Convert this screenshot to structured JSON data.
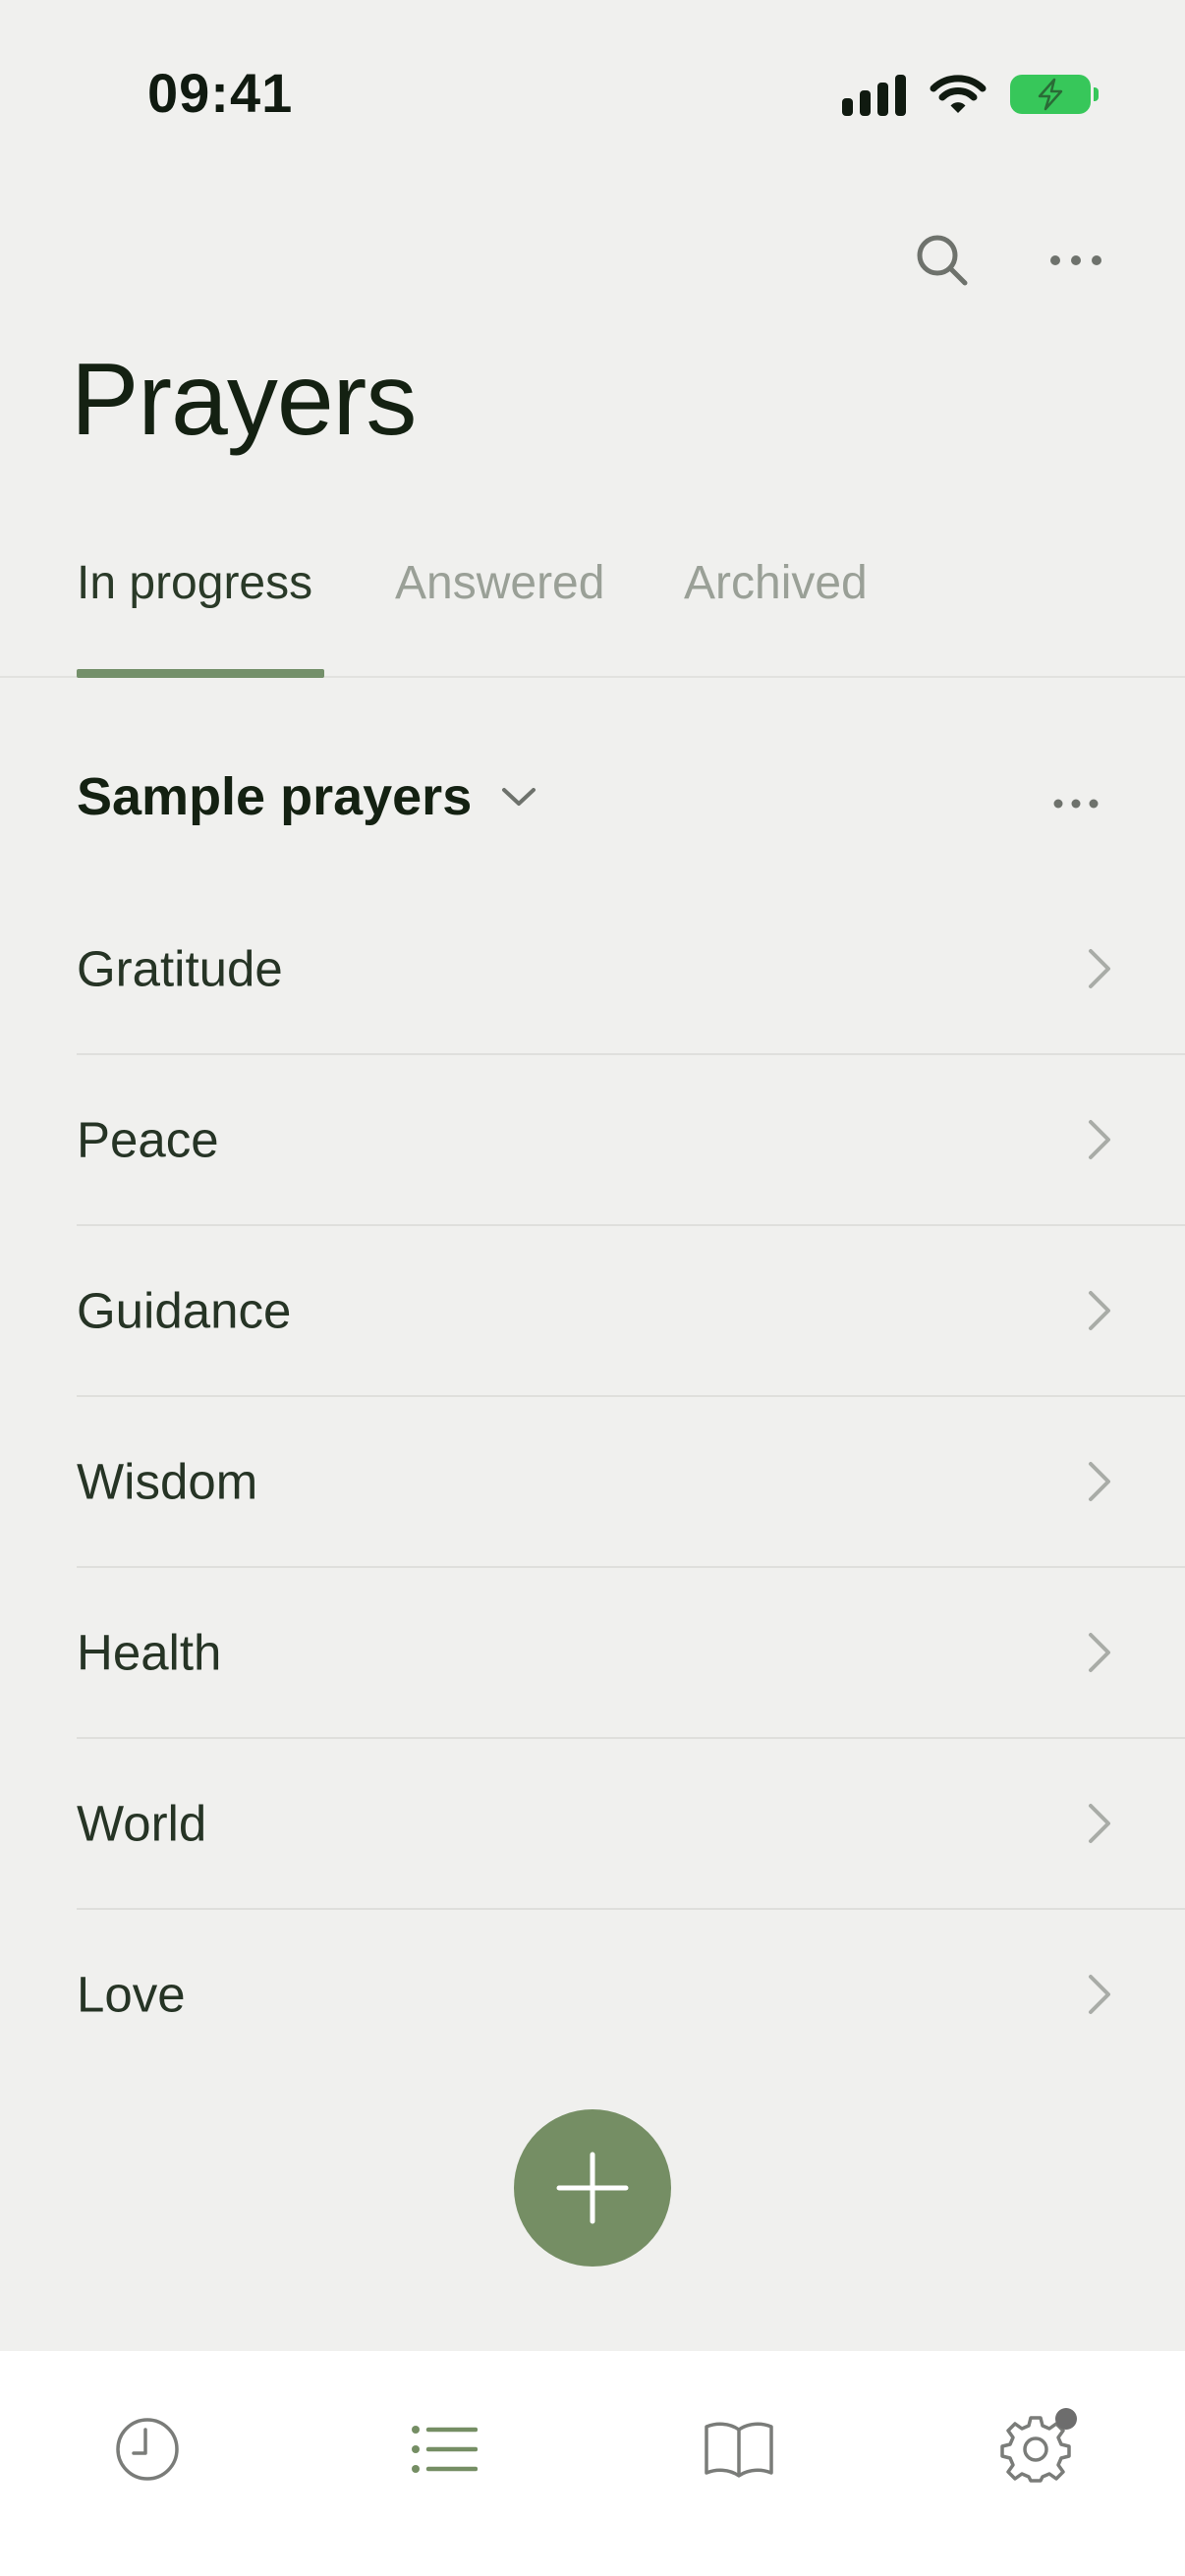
{
  "status_bar": {
    "time": "09:41"
  },
  "header": {
    "title": "Prayers",
    "icons": [
      "search-icon",
      "more-icon"
    ]
  },
  "tabs": [
    {
      "label": "In progress",
      "active": true
    },
    {
      "label": "Answered",
      "active": false
    },
    {
      "label": "Archived",
      "active": false
    }
  ],
  "section": {
    "title": "Sample prayers",
    "icons": [
      "chevron-down-icon",
      "more-icon"
    ]
  },
  "prayers": [
    {
      "label": "Gratitude"
    },
    {
      "label": "Peace"
    },
    {
      "label": "Guidance"
    },
    {
      "label": "Wisdom"
    },
    {
      "label": "Health"
    },
    {
      "label": "World"
    },
    {
      "label": "Love"
    }
  ],
  "fab": {
    "icon": "plus-icon"
  },
  "bottom_nav": [
    {
      "icon": "clock-icon",
      "active": false
    },
    {
      "icon": "list-icon",
      "active": true
    },
    {
      "icon": "book-icon",
      "active": false
    },
    {
      "icon": "settings-icon",
      "active": false,
      "badge": true
    }
  ],
  "colors": {
    "accent": "#758e64",
    "background": "#f0f0ee",
    "text_primary": "#142112",
    "text_inactive": "#9aa097",
    "battery": "#37c75a"
  }
}
